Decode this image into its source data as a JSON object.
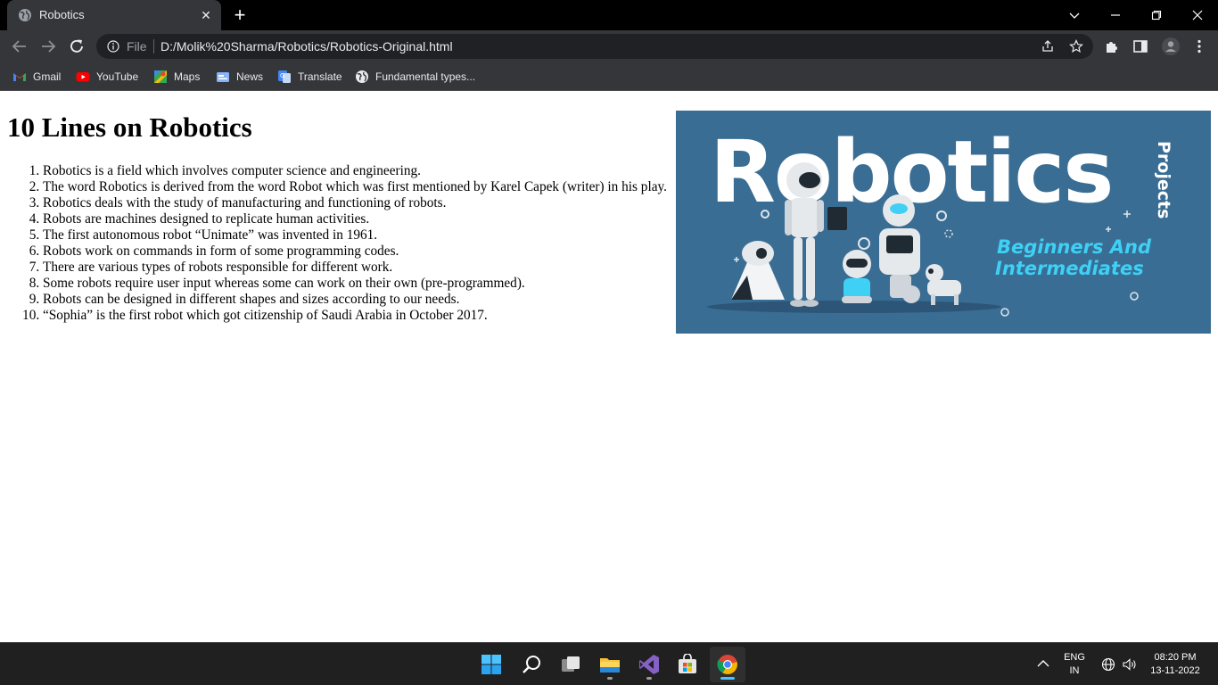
{
  "browser": {
    "tab_title": "Robotics",
    "new_tab_label": "+",
    "close_label": "✕",
    "file_label": "File",
    "url": "D:/Molik%20Sharma/Robotics/Robotics-Original.html"
  },
  "bookmarks": [
    {
      "label": "Gmail",
      "icon": "gmail-icon"
    },
    {
      "label": "YouTube",
      "icon": "youtube-icon"
    },
    {
      "label": "Maps",
      "icon": "maps-icon"
    },
    {
      "label": "News",
      "icon": "news-icon"
    },
    {
      "label": "Translate",
      "icon": "translate-icon"
    },
    {
      "label": "Fundamental types...",
      "icon": "globe-icon"
    }
  ],
  "page": {
    "heading": "10 Lines on Robotics",
    "lines": [
      "Robotics is a field which involves computer science and engineering.",
      "The word Robotics is derived from the word Robot which was first mentioned by Karel Capek (writer) in his play.",
      "Robotics deals with the study of manufacturing and functioning of robots.",
      "Robots are machines designed to replicate human activities.",
      "The first autonomous robot “Unimate” was invented in 1961.",
      "Robots work on commands in form of some programming codes.",
      "There are various types of robots responsible for different work.",
      "Some robots require user input whereas some can work on their own (pre-programmed).",
      "Robots can be designed in different shapes and sizes according to our needs.",
      "“Sophia” is the first robot which got citizenship of Saudi Arabia in October 2017."
    ],
    "hero_image": {
      "title": "Robotics",
      "side_label": "Projects",
      "subtitle_line1": "Beginners And",
      "subtitle_line2": "Intermediates"
    }
  },
  "taskbar": {
    "apps": [
      "start-icon",
      "search-icon",
      "task-view-icon",
      "file-explorer-icon",
      "visual-studio-icon",
      "microsoft-store-icon",
      "chrome-icon"
    ],
    "lang_line1": "ENG",
    "lang_line2": "IN",
    "time": "08:20 PM",
    "date": "13-11-2022"
  },
  "colors": {
    "tab_bg": "#35363a",
    "omnibox_bg": "#202124",
    "hero_bg": "#3a6d93",
    "hero_subtitle": "#3fd0f5",
    "taskbar_bg": "#202020"
  }
}
